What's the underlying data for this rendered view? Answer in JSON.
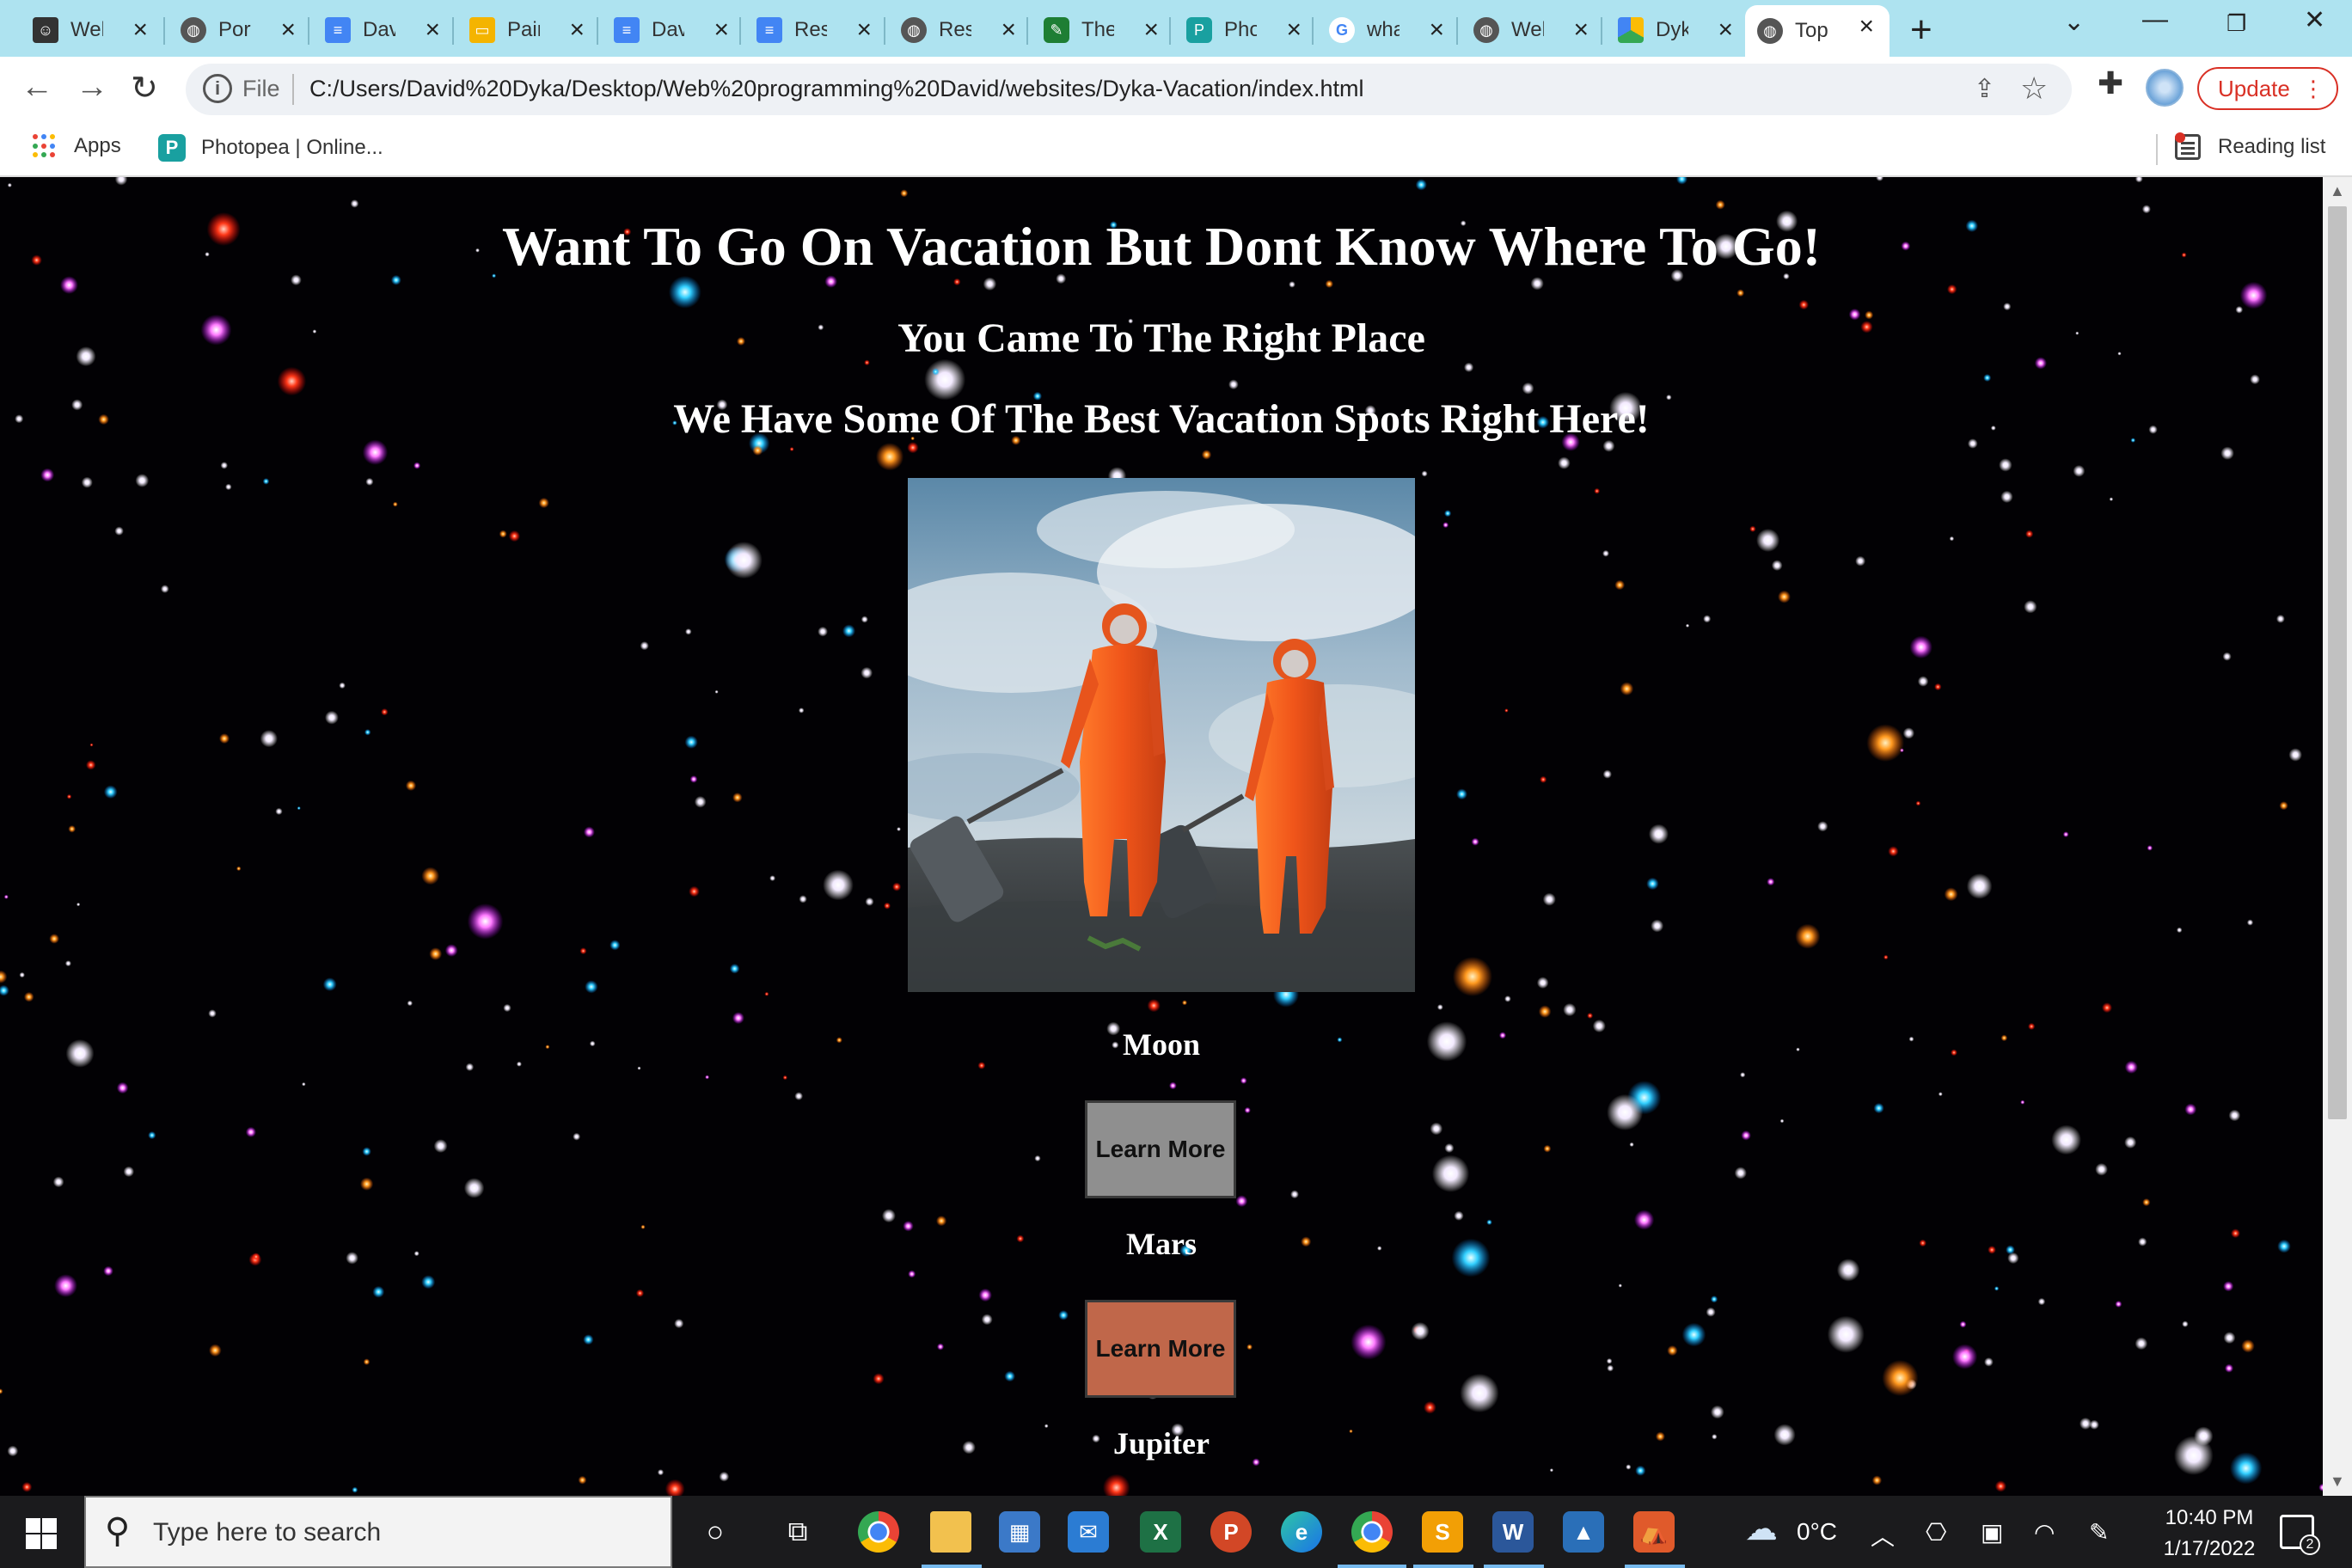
{
  "tabs": [
    {
      "title": "Wel",
      "favicon": "person-card-icon",
      "color": "#333333"
    },
    {
      "title": "Port",
      "favicon": "globe-icon",
      "color": "#555555"
    },
    {
      "title": "Dav",
      "favicon": "docs-icon",
      "color": "#4285f4"
    },
    {
      "title": "Pair",
      "favicon": "slides-icon",
      "color": "#f4b400"
    },
    {
      "title": "Dav",
      "favicon": "docs-icon",
      "color": "#4285f4"
    },
    {
      "title": "Resp",
      "favicon": "docs-icon",
      "color": "#4285f4"
    },
    {
      "title": "Res",
      "favicon": "globe-icon",
      "color": "#555555"
    },
    {
      "title": "The",
      "favicon": "leaf-icon",
      "color": "#1e7e34"
    },
    {
      "title": "Pho",
      "favicon": "photopea-icon",
      "color": "#19a0a0"
    },
    {
      "title": "wha",
      "favicon": "google-icon",
      "color": "#ffffff"
    },
    {
      "title": "Wel",
      "favicon": "globe-icon",
      "color": "#555555"
    },
    {
      "title": "Dyk",
      "favicon": "drive-icon",
      "color": "#34a853"
    },
    {
      "title": "Top",
      "favicon": "globe-icon",
      "color": "#555555",
      "active": true
    }
  ],
  "address_bar": {
    "scheme_label": "File",
    "url": "C:/Users/David%20Dyka/Desktop/Web%20programming%20David/websites/Dyka-Vacation/index.html"
  },
  "update_button": "Update",
  "bookmarks": {
    "apps": "Apps",
    "photopea": "Photopea | Online...",
    "reading_list": "Reading list"
  },
  "page": {
    "heading": "Want To Go On Vacation But Dont Know Where To Go!",
    "subheading": "You Came To The Right Place",
    "tagline": "We Have Some Of The Best Vacation Spots Right Here!",
    "destinations": [
      {
        "name": "Moon",
        "button": "Learn More",
        "button_color": "#8f8f8f"
      },
      {
        "name": "Mars",
        "button": "Learn More",
        "button_color": "#c0674a"
      },
      {
        "name": "Jupiter"
      }
    ]
  },
  "taskbar": {
    "search_placeholder": "Type here to search",
    "temperature": "0°C",
    "time": "10:40 PM",
    "date": "1/17/2022",
    "notification_count": "2"
  }
}
